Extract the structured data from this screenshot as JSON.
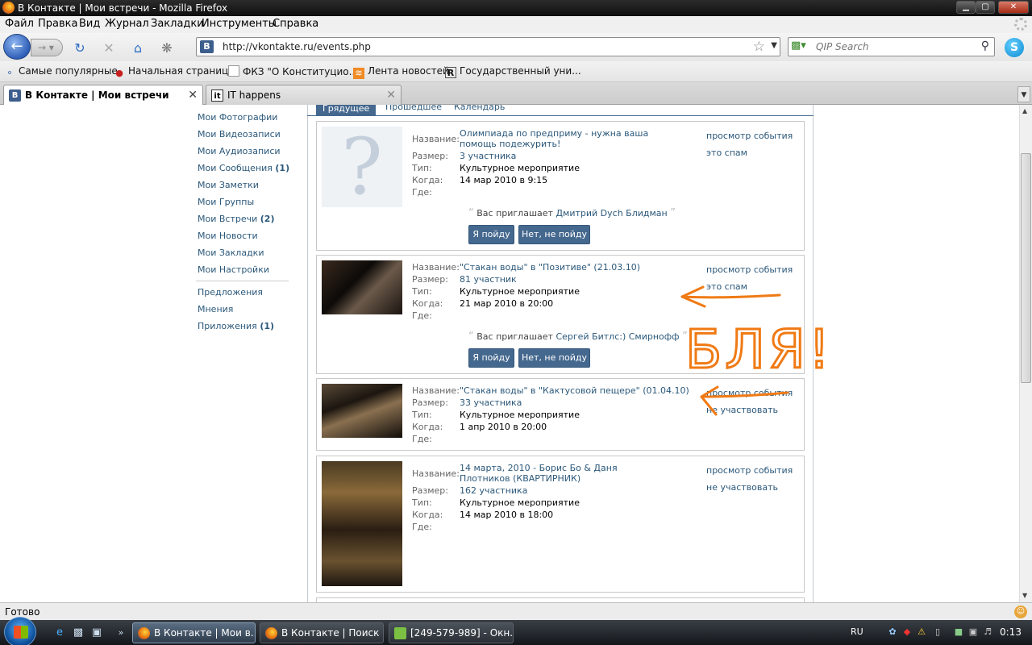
{
  "window": {
    "title": "В Контакте | Мои встречи - Mozilla Firefox",
    "min": "▁",
    "max": "▢",
    "close": "✕"
  },
  "menu": [
    "Файл",
    "Правка",
    "Вид",
    "Журнал",
    "Закладки",
    "Инструменты",
    "Справка"
  ],
  "nav": {
    "url": "http://vkontakte.ru/events.php",
    "search_placeholder": "QIP Search",
    "site_icon": "В"
  },
  "bookmarks": [
    "Самые популярные",
    "Начальная страница",
    "ФКЗ \"О Конституцио...",
    "Лента новостей",
    "Государственный уни..."
  ],
  "tabs": [
    {
      "label": "В Контакте | Мои встречи",
      "icon": "В"
    },
    {
      "label": "IT happens",
      "icon": "it"
    }
  ],
  "sidebar": {
    "items": [
      {
        "label": "Мои Фотографии",
        "count": ""
      },
      {
        "label": "Мои Видеозаписи",
        "count": ""
      },
      {
        "label": "Мои Аудиозаписи",
        "count": ""
      },
      {
        "label": "Мои Сообщения",
        "count": "(1)"
      },
      {
        "label": "Мои Заметки",
        "count": ""
      },
      {
        "label": "Мои Группы",
        "count": ""
      },
      {
        "label": "Мои Встречи",
        "count": "(2)"
      },
      {
        "label": "Мои Новости",
        "count": ""
      },
      {
        "label": "Мои Закладки",
        "count": ""
      },
      {
        "label": "Мои Настройки",
        "count": ""
      }
    ],
    "extra": [
      {
        "label": "Предложения",
        "count": ""
      },
      {
        "label": "Мнения",
        "count": ""
      },
      {
        "label": "Приложения",
        "count": "(1)"
      }
    ]
  },
  "subtabs": [
    "Грядущее",
    "Прошедшее",
    "Календарь"
  ],
  "labels": {
    "name": "Название:",
    "size": "Размер:",
    "type": "Тип:",
    "when": "Когда:",
    "where": "Где:",
    "invited_by": "Вас приглашает",
    "go": "Я пойду",
    "no_go": "Нет, не пойду"
  },
  "events": [
    {
      "name": "Олимпиада по предприму - нужна ваша помощь подежурить!",
      "size": "3 участника",
      "type": "Культурное мероприятие",
      "when": "14 мар 2010 в 9:15",
      "where": "",
      "inviter": "Дмитрий Dych Блидман",
      "links": [
        "просмотр события",
        "это спам"
      ]
    },
    {
      "name": "\"Стакан воды\" в \"Позитиве\" (21.03.10)",
      "size": "81 участник",
      "type": "Культурное мероприятие",
      "when": "21 мар 2010 в 20:00",
      "where": "",
      "inviter": "Сергей Битлс:) Смирнофф",
      "links": [
        "просмотр события",
        "это спам"
      ]
    },
    {
      "name": "\"Стакан воды\" в \"Кактусовой пещере\" (01.04.10)",
      "size": "33 участника",
      "type": "Культурное мероприятие",
      "when": "1 апр 2010 в 20:00",
      "where": "",
      "links": [
        "просмотр события",
        "не участвовать"
      ]
    },
    {
      "name": "14 марта, 2010 - Борис Бо & Даня Плотников (КВАРТИРНИК)",
      "size": "162 участника",
      "type": "Культурное мероприятие",
      "when": "14 мар 2010 в 18:00",
      "where": "",
      "links": [
        "просмотр события",
        "не участвовать"
      ]
    }
  ],
  "annotation_text": "БЛЯ!",
  "status": "Готово",
  "taskbar": {
    "buttons": [
      "В Контакте | Мои в...",
      "В Контакте | Поиск ...",
      "[249-579-989] - Окн..."
    ],
    "lang": "RU",
    "clock": "0:13"
  },
  "colors": {
    "vk_blue": "#45688e",
    "vk_link": "#2b587a",
    "annotation": "#f07a14"
  }
}
